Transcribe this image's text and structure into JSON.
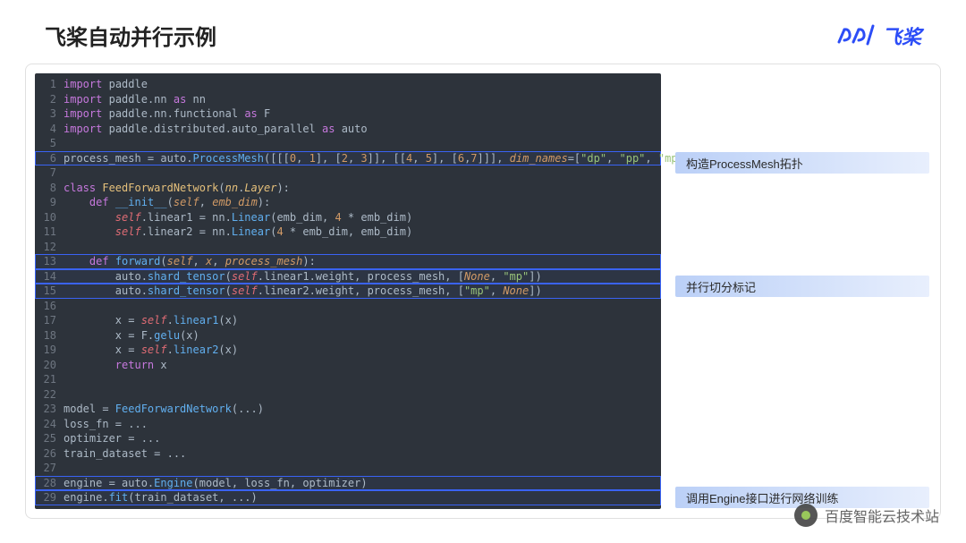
{
  "header": {
    "title": "飞桨自动并行示例",
    "brand": "飞桨"
  },
  "annotations": {
    "a1": "构造ProcessMesh拓扑",
    "a2": "并行切分标记",
    "a3": "调用Engine接口进行网络训练"
  },
  "code": {
    "lines": [
      {
        "n": 1,
        "hl": false,
        "tokens": [
          [
            "c-key",
            "import"
          ],
          [
            "c-op",
            " "
          ],
          [
            "c-mod",
            "paddle"
          ]
        ]
      },
      {
        "n": 2,
        "hl": false,
        "tokens": [
          [
            "c-key",
            "import"
          ],
          [
            "c-op",
            " "
          ],
          [
            "c-mod",
            "paddle.nn "
          ],
          [
            "c-key",
            "as"
          ],
          [
            "c-op",
            " "
          ],
          [
            "c-mod",
            "nn"
          ]
        ]
      },
      {
        "n": 3,
        "hl": false,
        "tokens": [
          [
            "c-key",
            "import"
          ],
          [
            "c-op",
            " "
          ],
          [
            "c-mod",
            "paddle.nn.functional "
          ],
          [
            "c-key",
            "as"
          ],
          [
            "c-op",
            " "
          ],
          [
            "c-mod",
            "F"
          ]
        ]
      },
      {
        "n": 4,
        "hl": false,
        "tokens": [
          [
            "c-key",
            "import"
          ],
          [
            "c-op",
            " "
          ],
          [
            "c-mod",
            "paddle.distributed.auto_parallel "
          ],
          [
            "c-key",
            "as"
          ],
          [
            "c-op",
            " "
          ],
          [
            "c-mod",
            "auto"
          ]
        ]
      },
      {
        "n": 5,
        "hl": false,
        "tokens": []
      },
      {
        "n": 6,
        "hl": true,
        "tokens": [
          [
            "c-op",
            "process_mesh = auto."
          ],
          [
            "c-func",
            "ProcessMesh"
          ],
          [
            "c-op",
            "([[["
          ],
          [
            "c-num",
            "0"
          ],
          [
            "c-op",
            ", "
          ],
          [
            "c-num",
            "1"
          ],
          [
            "c-op",
            "], ["
          ],
          [
            "c-num",
            "2"
          ],
          [
            "c-op",
            ", "
          ],
          [
            "c-num",
            "3"
          ],
          [
            "c-op",
            "]], [["
          ],
          [
            "c-num",
            "4"
          ],
          [
            "c-op",
            ", "
          ],
          [
            "c-num",
            "5"
          ],
          [
            "c-op",
            "], ["
          ],
          [
            "c-num",
            "6"
          ],
          [
            "c-op",
            ","
          ],
          [
            "c-num",
            "7"
          ],
          [
            "c-op",
            "]]], "
          ],
          [
            "c-arg",
            "dim_names"
          ],
          [
            "c-op",
            "=["
          ],
          [
            "c-str",
            "\"dp\""
          ],
          [
            "c-op",
            ", "
          ],
          [
            "c-str",
            "\"pp\""
          ],
          [
            "c-op",
            ", "
          ],
          [
            "c-str",
            "\"mp\""
          ],
          [
            "c-op",
            "])"
          ]
        ]
      },
      {
        "n": 7,
        "hl": false,
        "tokens": []
      },
      {
        "n": 8,
        "hl": false,
        "tokens": [
          [
            "c-key",
            "class"
          ],
          [
            "c-op",
            " "
          ],
          [
            "c-cls",
            "FeedForwardNetwork"
          ],
          [
            "c-op",
            "("
          ],
          [
            "c-type",
            "nn"
          ],
          [
            "c-op",
            "."
          ],
          [
            "c-type",
            "Layer"
          ],
          [
            "c-op",
            "):"
          ]
        ]
      },
      {
        "n": 9,
        "hl": false,
        "tokens": [
          [
            "c-op",
            "    "
          ],
          [
            "c-key",
            "def"
          ],
          [
            "c-op",
            " "
          ],
          [
            "c-func",
            "__init__"
          ],
          [
            "c-op",
            "("
          ],
          [
            "c-self",
            "self"
          ],
          [
            "c-op",
            ", "
          ],
          [
            "c-arg",
            "emb_dim"
          ],
          [
            "c-op",
            "):"
          ]
        ]
      },
      {
        "n": 10,
        "hl": false,
        "tokens": [
          [
            "c-op",
            "        "
          ],
          [
            "c-selfc",
            "self"
          ],
          [
            "c-op",
            ".linear1 = nn."
          ],
          [
            "c-func",
            "Linear"
          ],
          [
            "c-op",
            "(emb_dim, "
          ],
          [
            "c-num",
            "4"
          ],
          [
            "c-op",
            " * emb_dim)"
          ]
        ]
      },
      {
        "n": 11,
        "hl": false,
        "tokens": [
          [
            "c-op",
            "        "
          ],
          [
            "c-selfc",
            "self"
          ],
          [
            "c-op",
            ".linear2 = nn."
          ],
          [
            "c-func",
            "Linear"
          ],
          [
            "c-op",
            "("
          ],
          [
            "c-num",
            "4"
          ],
          [
            "c-op",
            " * emb_dim, emb_dim)"
          ]
        ]
      },
      {
        "n": 12,
        "hl": false,
        "tokens": []
      },
      {
        "n": 13,
        "hl": true,
        "tokens": [
          [
            "c-op",
            "    "
          ],
          [
            "c-key",
            "def"
          ],
          [
            "c-op",
            " "
          ],
          [
            "c-func",
            "forward"
          ],
          [
            "c-op",
            "("
          ],
          [
            "c-self",
            "self"
          ],
          [
            "c-op",
            ", "
          ],
          [
            "c-arg",
            "x"
          ],
          [
            "c-op",
            ", "
          ],
          [
            "c-arg",
            "process_mesh"
          ],
          [
            "c-op",
            "):"
          ]
        ]
      },
      {
        "n": 14,
        "hl": true,
        "tokens": [
          [
            "c-op",
            "        auto."
          ],
          [
            "c-func",
            "shard_tensor"
          ],
          [
            "c-op",
            "("
          ],
          [
            "c-selfc",
            "self"
          ],
          [
            "c-op",
            ".linear1.weight, process_mesh, ["
          ],
          [
            "c-none",
            "None"
          ],
          [
            "c-op",
            ", "
          ],
          [
            "c-str",
            "\"mp\""
          ],
          [
            "c-op",
            "])"
          ]
        ]
      },
      {
        "n": 15,
        "hl": true,
        "tokens": [
          [
            "c-op",
            "        auto."
          ],
          [
            "c-func",
            "shard_tensor"
          ],
          [
            "c-op",
            "("
          ],
          [
            "c-selfc",
            "self"
          ],
          [
            "c-op",
            ".linear2.weight, process_mesh, ["
          ],
          [
            "c-str",
            "\"mp\""
          ],
          [
            "c-op",
            ", "
          ],
          [
            "c-none",
            "None"
          ],
          [
            "c-op",
            "])"
          ]
        ]
      },
      {
        "n": 16,
        "hl": false,
        "tokens": []
      },
      {
        "n": 17,
        "hl": false,
        "tokens": [
          [
            "c-op",
            "        x = "
          ],
          [
            "c-selfc",
            "self"
          ],
          [
            "c-op",
            "."
          ],
          [
            "c-func",
            "linear1"
          ],
          [
            "c-op",
            "(x)"
          ]
        ]
      },
      {
        "n": 18,
        "hl": false,
        "tokens": [
          [
            "c-op",
            "        x = F."
          ],
          [
            "c-func",
            "gelu"
          ],
          [
            "c-op",
            "(x)"
          ]
        ]
      },
      {
        "n": 19,
        "hl": false,
        "tokens": [
          [
            "c-op",
            "        x = "
          ],
          [
            "c-selfc",
            "self"
          ],
          [
            "c-op",
            "."
          ],
          [
            "c-func",
            "linear2"
          ],
          [
            "c-op",
            "(x)"
          ]
        ]
      },
      {
        "n": 20,
        "hl": false,
        "tokens": [
          [
            "c-op",
            "        "
          ],
          [
            "c-key",
            "return"
          ],
          [
            "c-op",
            " x"
          ]
        ]
      },
      {
        "n": 21,
        "hl": false,
        "tokens": []
      },
      {
        "n": 22,
        "hl": false,
        "tokens": []
      },
      {
        "n": 23,
        "hl": false,
        "tokens": [
          [
            "c-op",
            "model = "
          ],
          [
            "c-func",
            "FeedForwardNetwork"
          ],
          [
            "c-op",
            "(...)"
          ]
        ]
      },
      {
        "n": 24,
        "hl": false,
        "tokens": [
          [
            "c-op",
            "loss_fn = ..."
          ]
        ]
      },
      {
        "n": 25,
        "hl": false,
        "tokens": [
          [
            "c-op",
            "optimizer = ..."
          ]
        ]
      },
      {
        "n": 26,
        "hl": false,
        "tokens": [
          [
            "c-op",
            "train_dataset = ..."
          ]
        ]
      },
      {
        "n": 27,
        "hl": false,
        "tokens": []
      },
      {
        "n": 28,
        "hl": true,
        "tokens": [
          [
            "c-op",
            "engine = auto."
          ],
          [
            "c-func",
            "Engine"
          ],
          [
            "c-op",
            "(model, loss_fn, optimizer)"
          ]
        ]
      },
      {
        "n": 29,
        "hl": true,
        "tokens": [
          [
            "c-op",
            "engine."
          ],
          [
            "c-func",
            "fit"
          ],
          [
            "c-op",
            "(train_dataset, ...)"
          ]
        ]
      }
    ]
  },
  "watermark": {
    "text": "百度智能云技术站"
  }
}
